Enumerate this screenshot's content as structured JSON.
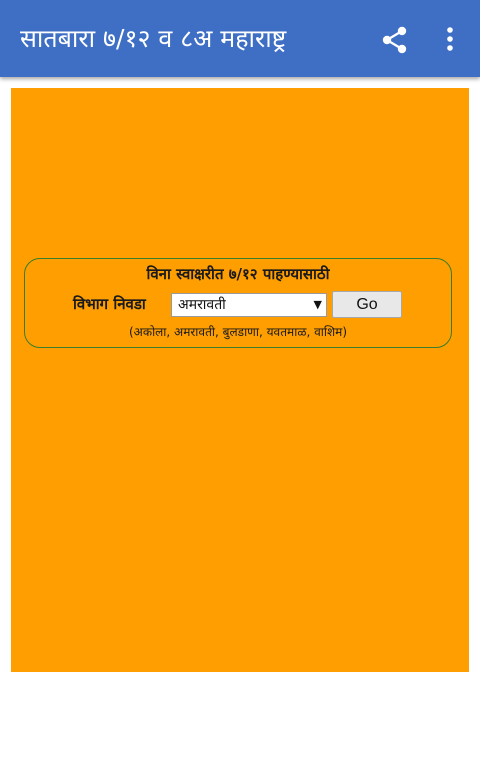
{
  "app": {
    "title": "सातबारा ७/१२ व ८अ महाराष्ट्र",
    "bar_color": "#3f6fc4",
    "share_icon": "share-icon",
    "menu_icon": "more-vert-icon"
  },
  "panel": {
    "background": "#ff9e00",
    "heading": "विना स्वाक्षरीत ७/१२ पाहण्यासाठी",
    "division_label": "विभाग निवडा",
    "division_selected": "अमरावती",
    "go_label": "Go",
    "note": "(अकोला, अमरावती, बुलडाणा, यवतमाळ, वाशिम)"
  }
}
